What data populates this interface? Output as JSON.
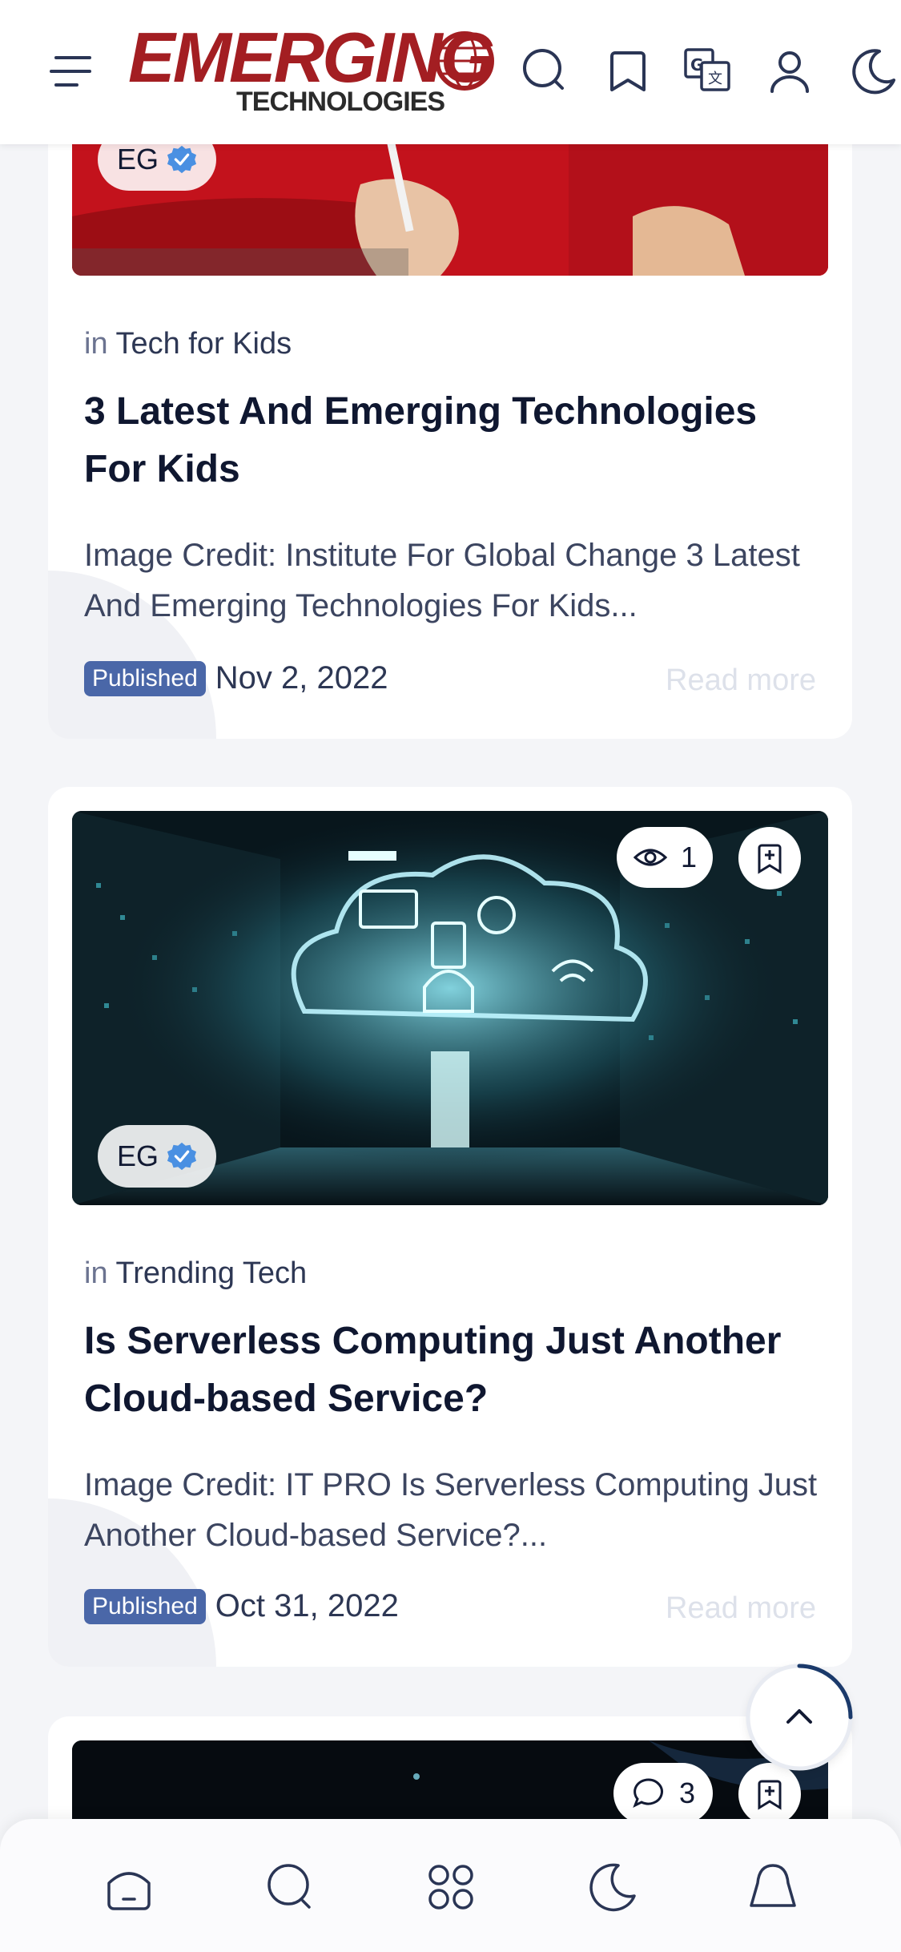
{
  "header": {
    "logo_main": "EMERGING",
    "logo_sub": "TECHNOLOGIES",
    "brand_color": "#a31e22"
  },
  "posts": [
    {
      "author_badge": "EG",
      "category_prefix": "in",
      "category": "Tech for Kids",
      "title": "3 Latest And Emerging Technologies For Kids",
      "excerpt": "Image Credit: Institute For Global Change 3 Latest And Emerging Technologies For Kids...",
      "published_label": "Published",
      "date": "Nov 2, 2022",
      "read_more": "Read more"
    },
    {
      "author_badge": "EG",
      "views": "1",
      "category_prefix": "in",
      "category": "Trending Tech",
      "title": "Is Serverless Computing Just Another Cloud-based Service?",
      "excerpt": "Image Credit: IT PRO   Is Serverless Computing Just Another Cloud-based Service?...",
      "published_label": "Published",
      "date": "Oct 31, 2022",
      "read_more": "Read more"
    },
    {
      "comments": "3"
    }
  ],
  "icons": {
    "header": [
      "menu-icon",
      "search-icon",
      "bookmark-icon",
      "translate-icon",
      "user-icon",
      "moon-icon"
    ],
    "bottom_nav": [
      "home-icon",
      "search-icon",
      "categories-icon",
      "moon-icon",
      "bell-icon"
    ]
  },
  "colors": {
    "published_badge": "#4a67a8",
    "accent_blue": "#1b3a6b",
    "verified": "#4a90e2"
  }
}
